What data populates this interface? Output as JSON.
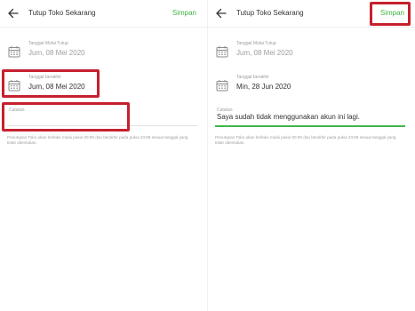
{
  "left": {
    "header": {
      "title": "Tutup Toko Sekarang",
      "save_label": "Simpan"
    },
    "start": {
      "label": "Tanggal Mulai Tutup",
      "value": "Jum, 08 Mei 2020"
    },
    "end": {
      "label": "Tanggal berakhir",
      "value": "Jum, 08 Mei 2020"
    },
    "note": {
      "label": "Catatan",
      "value": ""
    },
    "hint": "Penutupan Toko akan berlaku mulai pukul 00:00 dan berakhir pada pukul 23:59 sesuai tanggal yang telah ditentukan."
  },
  "right": {
    "header": {
      "title": "Tutup Toko Sekarang",
      "save_label": "Simpan"
    },
    "start": {
      "label": "Tanggal Mulai Tutup",
      "value": "Jum, 08 Mei 2020"
    },
    "end": {
      "label": "Tanggal berakhir",
      "value": "Min, 28 Jun 2020"
    },
    "note": {
      "label": "Catatan",
      "value": "Saya sudah tidak menggunakan akun ini lagi."
    },
    "hint": "Penutupan Toko akan berlaku mulai pukul 00:00 dan berakhir pada pukul 23:59 sesuai tanggal yang telah ditentukan."
  },
  "colors": {
    "accent": "#42b549",
    "highlight": "#c6202e",
    "muted": "#9e9e9e"
  },
  "icons": {
    "back": "arrow-left-icon",
    "calendar": "calendar-icon"
  }
}
